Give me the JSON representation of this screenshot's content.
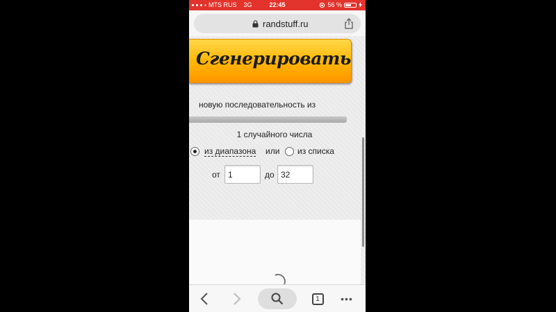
{
  "status_bar": {
    "carrier": "MTS RUS",
    "network": "3G",
    "time": "22:45",
    "battery": "56 %",
    "battery_level": 0.56
  },
  "address_bar": {
    "url": "randstuff.ru"
  },
  "page": {
    "generate_label": "Сгенерировать",
    "sequence_text": "новую последовательность из",
    "count_text": "1 случайного числа",
    "range_option_label": "из диапазона",
    "or_text": "или",
    "list_option_label": "из списка",
    "from_label": "от",
    "from_value": "1",
    "to_label": "до",
    "to_value": "32"
  },
  "toolbar": {
    "tabs_count": "1",
    "menu_glyph": "•••"
  },
  "colors": {
    "status_bar": "#e2342c",
    "button_top": "#ffd84a",
    "button_bottom": "#ff9500"
  }
}
